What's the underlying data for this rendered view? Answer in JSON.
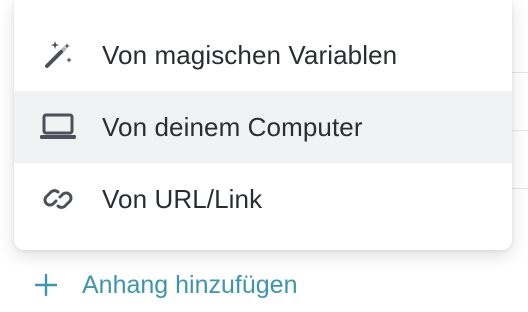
{
  "menu": {
    "items": [
      {
        "label": "Von magischen Variablen",
        "icon": "magic-wand-icon"
      },
      {
        "label": "Von deinem Computer",
        "icon": "laptop-icon"
      },
      {
        "label": "Von URL/Link",
        "icon": "link-icon"
      }
    ],
    "active_index": 1
  },
  "add_attachment": {
    "label": "Anhang hinzufügen",
    "icon": "plus-icon"
  },
  "colors": {
    "accent": "#3d95b0",
    "menu_text": "#2a2d32",
    "icon": "#4d5157",
    "active_bg": "#f1f2f4"
  }
}
